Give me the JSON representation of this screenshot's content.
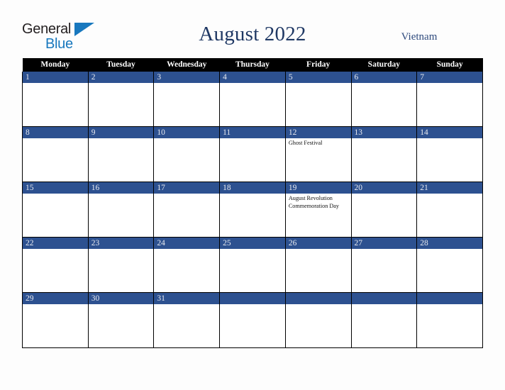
{
  "brand": {
    "name_part1": "General",
    "name_part2": "Blue",
    "triangle_icon": "blue-triangle-icon",
    "color_dark": "#231f20",
    "color_blue": "#1878be"
  },
  "header": {
    "title": "August 2022",
    "country": "Vietnam",
    "title_color": "#1f3864",
    "country_color": "#2e4a7d"
  },
  "calendar": {
    "month": "August",
    "year": "2022",
    "weekday_headers": [
      "Monday",
      "Tuesday",
      "Wednesday",
      "Thursday",
      "Friday",
      "Saturday",
      "Sunday"
    ],
    "header_bg": "#000000",
    "daynum_bg": "#2d5190",
    "daynum_color": "#e8eaf0",
    "cell_bg": "#ffffff",
    "weeks": [
      [
        {
          "day": "1",
          "events": []
        },
        {
          "day": "2",
          "events": []
        },
        {
          "day": "3",
          "events": []
        },
        {
          "day": "4",
          "events": []
        },
        {
          "day": "5",
          "events": []
        },
        {
          "day": "6",
          "events": []
        },
        {
          "day": "7",
          "events": []
        }
      ],
      [
        {
          "day": "8",
          "events": []
        },
        {
          "day": "9",
          "events": []
        },
        {
          "day": "10",
          "events": []
        },
        {
          "day": "11",
          "events": []
        },
        {
          "day": "12",
          "events": [
            "Ghost Festival"
          ]
        },
        {
          "day": "13",
          "events": []
        },
        {
          "day": "14",
          "events": []
        }
      ],
      [
        {
          "day": "15",
          "events": []
        },
        {
          "day": "16",
          "events": []
        },
        {
          "day": "17",
          "events": []
        },
        {
          "day": "18",
          "events": []
        },
        {
          "day": "19",
          "events": [
            "August Revolution Commemoration Day"
          ]
        },
        {
          "day": "20",
          "events": []
        },
        {
          "day": "21",
          "events": []
        }
      ],
      [
        {
          "day": "22",
          "events": []
        },
        {
          "day": "23",
          "events": []
        },
        {
          "day": "24",
          "events": []
        },
        {
          "day": "25",
          "events": []
        },
        {
          "day": "26",
          "events": []
        },
        {
          "day": "27",
          "events": []
        },
        {
          "day": "28",
          "events": []
        }
      ],
      [
        {
          "day": "29",
          "events": []
        },
        {
          "day": "30",
          "events": []
        },
        {
          "day": "31",
          "events": []
        },
        {
          "day": "",
          "events": []
        },
        {
          "day": "",
          "events": []
        },
        {
          "day": "",
          "events": []
        },
        {
          "day": "",
          "events": []
        }
      ]
    ]
  }
}
